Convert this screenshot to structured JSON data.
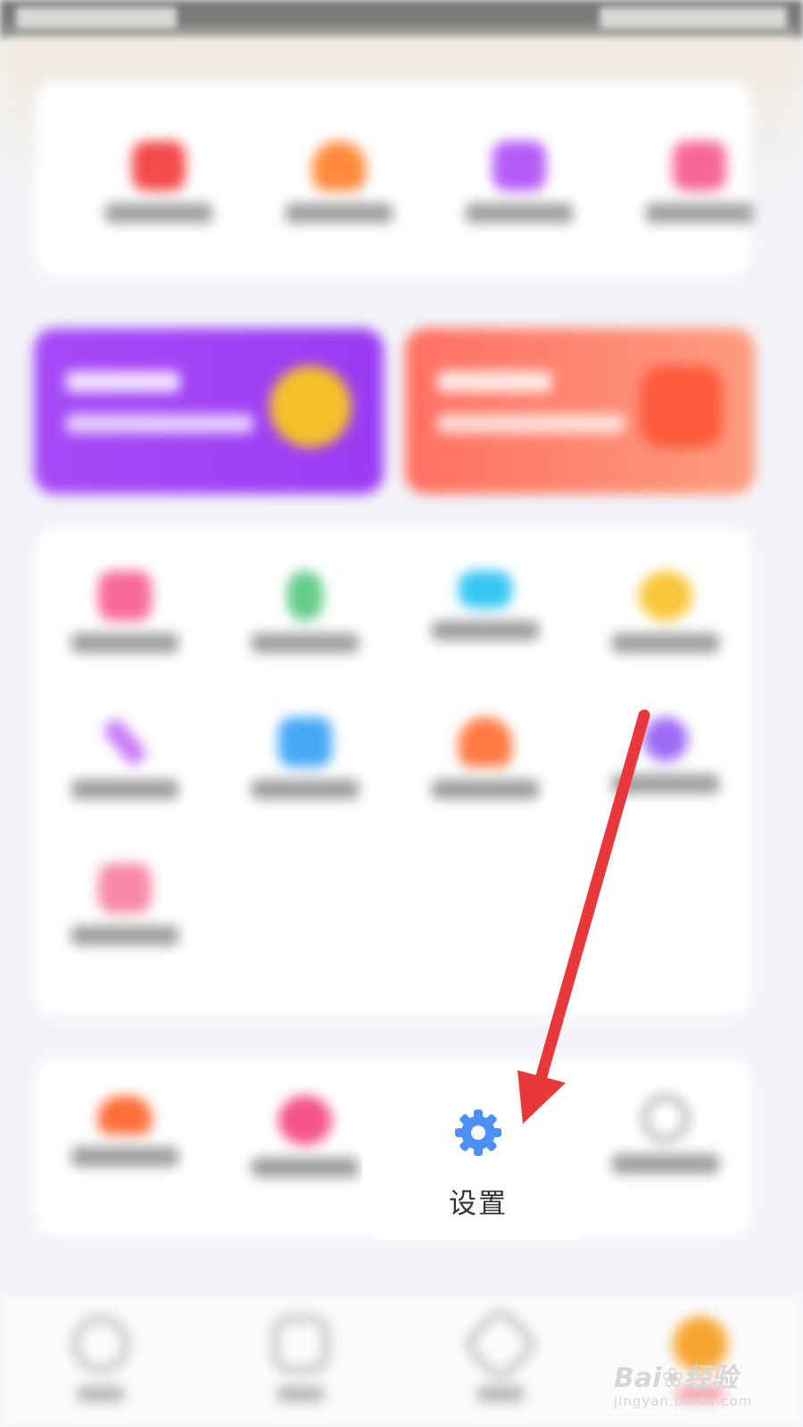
{
  "settings": {
    "label": "设置",
    "icon": "gear-icon",
    "icon_color": "#4a90f5"
  },
  "watermark": {
    "brand": "Bai",
    "brand_cn": "经验",
    "url": "jingyan.baidu.com"
  },
  "annotation": {
    "type": "arrow",
    "color": "#e8383a",
    "points_to": "settings-item"
  },
  "colors": {
    "banner_left": "#a24ef8",
    "banner_right": "#ff7b6b",
    "background": "#f3f3f8"
  },
  "top_grid_icons": [
    "video-icon",
    "bag-icon",
    "calendar-icon",
    "gift-icon"
  ],
  "middle_grid_icons": [
    "photo-icon",
    "bottle-icon",
    "crown-icon",
    "coin-icon",
    "pen-icon",
    "download-icon",
    "person-icon",
    "star-icon",
    "chat-icon"
  ],
  "bottom_row_icons": [
    "cloud-icon",
    "heart-icon",
    "gear-icon",
    "smile-icon"
  ],
  "tab_icons": [
    "home-icon",
    "house-icon",
    "send-icon",
    "profile-icon"
  ]
}
